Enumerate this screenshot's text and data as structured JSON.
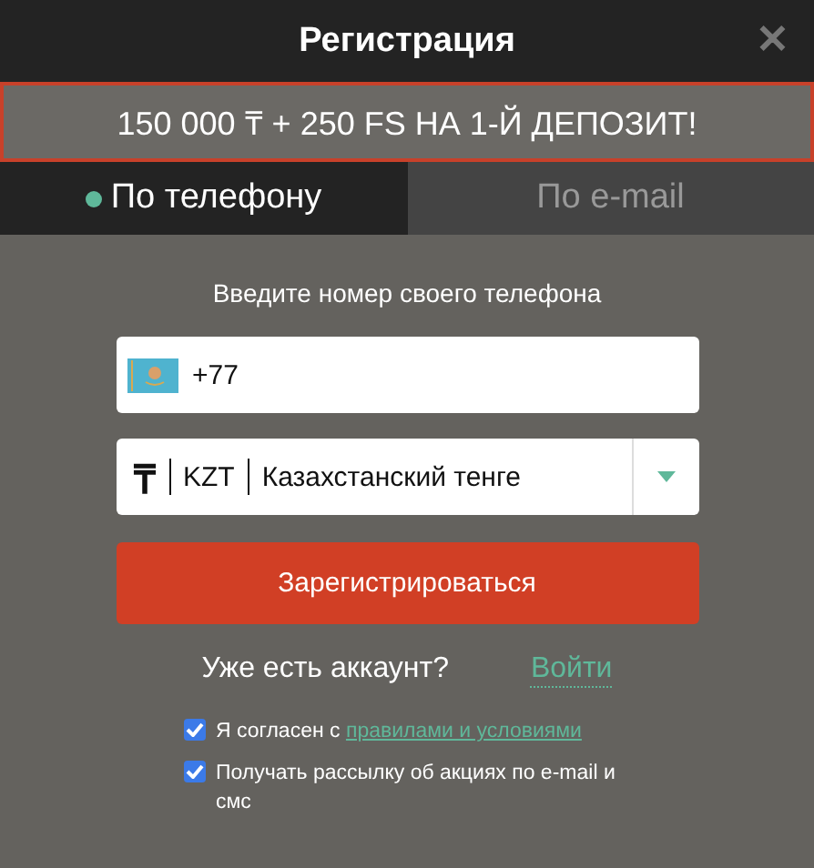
{
  "window": {
    "title": "Регистрация",
    "close": "✕"
  },
  "promo": "150 000 ₸ + 250 FS НА 1-Й ДЕПОЗИТ!",
  "tabs": [
    {
      "label": "По телефону",
      "selected": true
    },
    {
      "label": "По e-mail",
      "selected": false
    }
  ],
  "prompt": "Введите номер своего телефона",
  "phone": {
    "value": "+77"
  },
  "currency": {
    "symbol": "₸",
    "code": "KZT",
    "name": "Казахстанский тенге"
  },
  "register_button": "Зарегистрироваться",
  "login": {
    "question": "Уже есть аккаунт?",
    "link": "Войти"
  },
  "checkboxes": [
    {
      "text": "Я согласен с ",
      "link": "правилами и условиями",
      "checked": true
    },
    {
      "text": "Получать рассылку об акциях по e-mail и смс",
      "checked": true
    }
  ]
}
